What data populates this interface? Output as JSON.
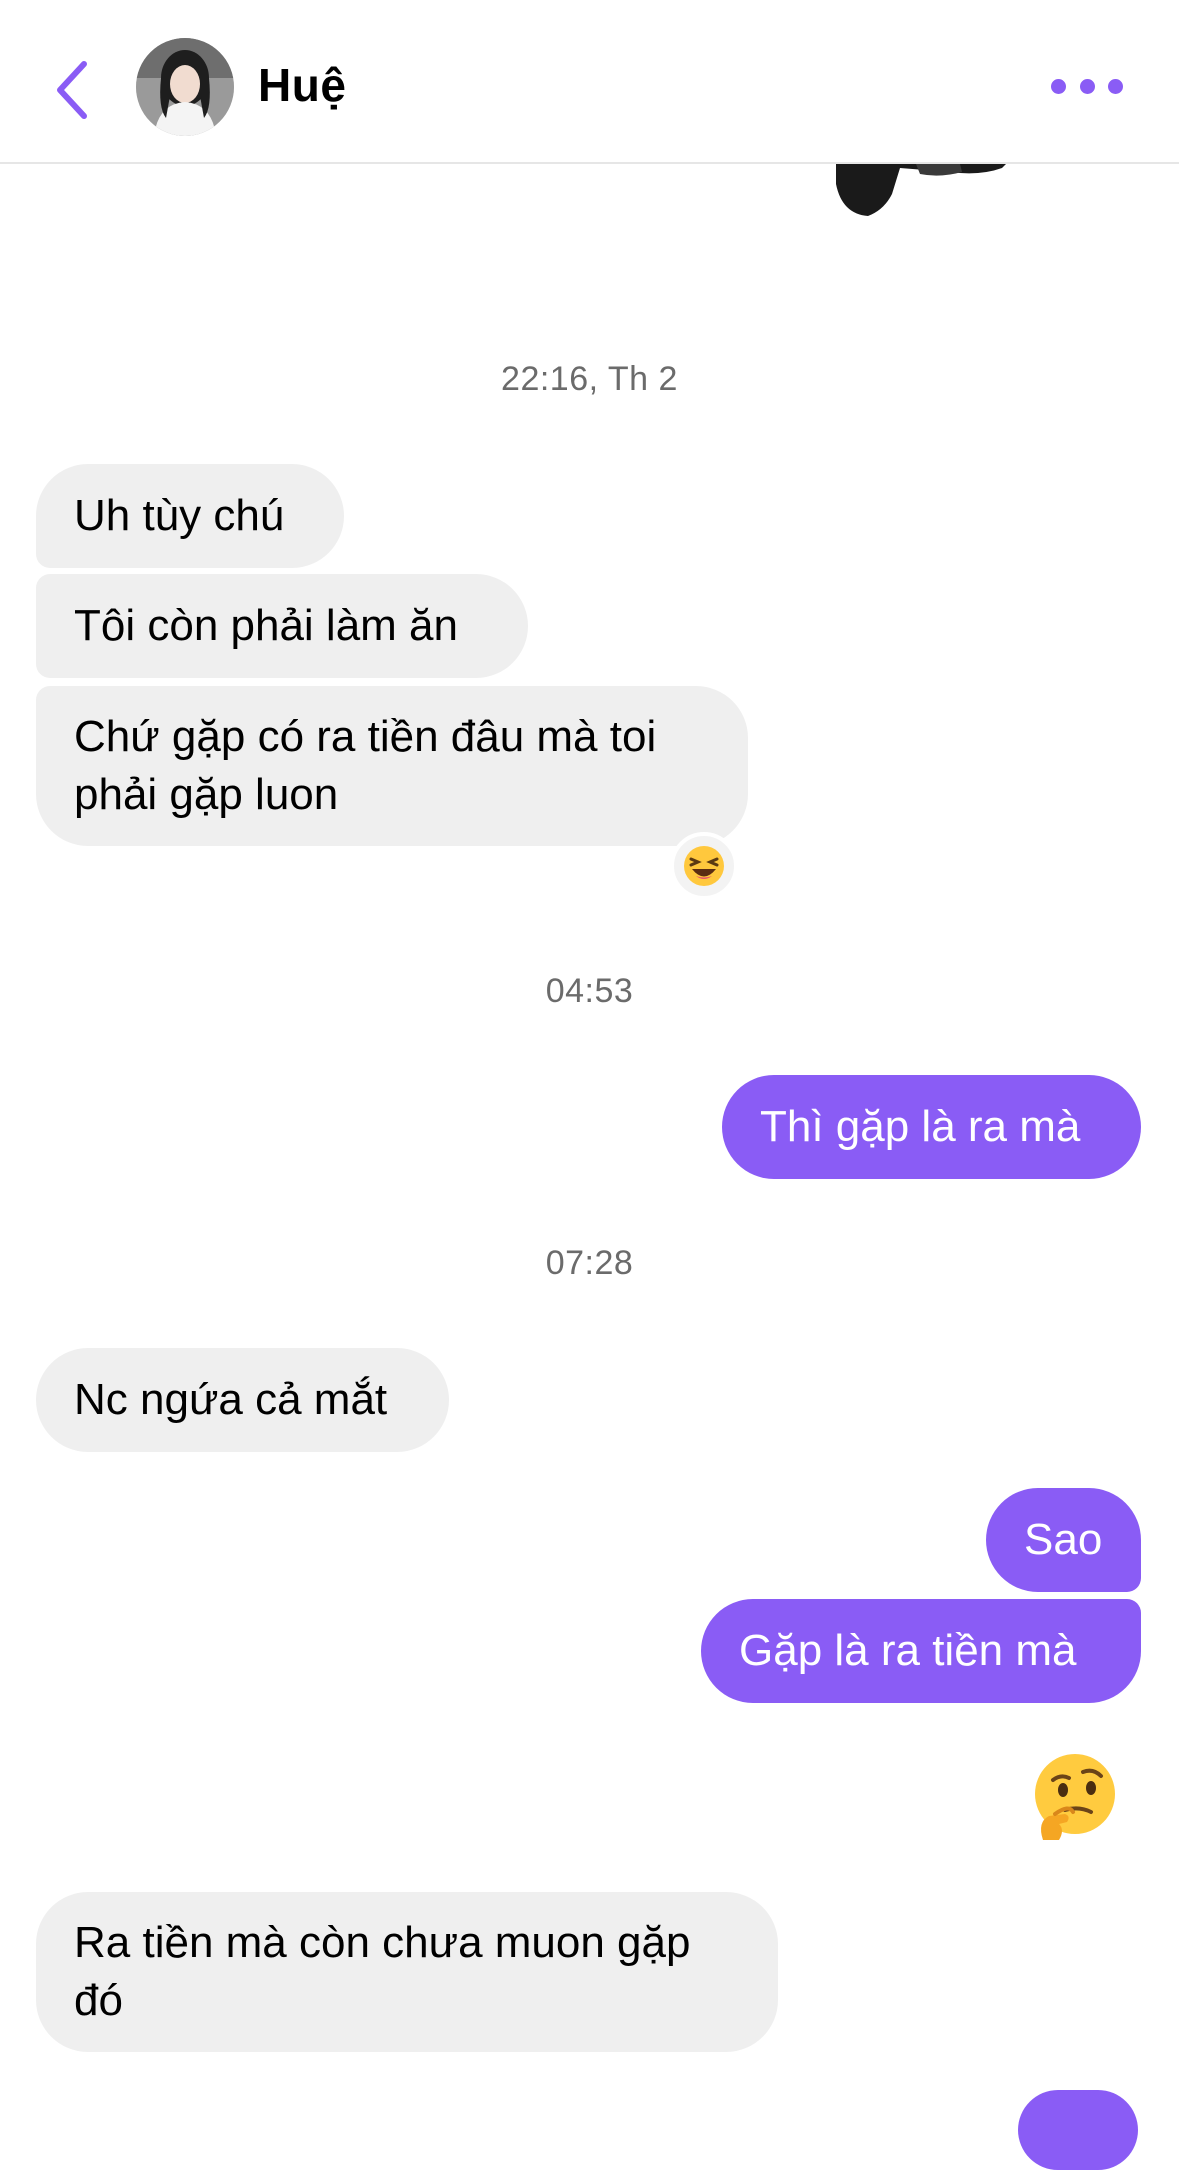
{
  "header": {
    "contact_name": "Huệ",
    "back_icon": "chevron-left-icon",
    "more_icon": "ellipsis-icon",
    "accent_color": "#8a5cf5"
  },
  "messages": {
    "timestamp_1": "22:16, Th 2",
    "m1": "Uh tùy chú",
    "m2": "Tôi còn phải làm ăn",
    "m3": "Chứ gặp có ra tiền đâu mà toi phải gặp luon",
    "m3_reaction": "laughing-face-emoji",
    "timestamp_2": "04:53",
    "m4": "Thì gặp là ra mà",
    "timestamp_3": "07:28",
    "m5": "Nc ngứa cả mắt",
    "m6": "Sao",
    "m7": "Gặp là ra tiền mà",
    "m8_emoji": "thinking-face-emoji",
    "m9": "Ra tiền mà còn chưa muon gặp đó"
  },
  "colors": {
    "incoming_bubble": "#efefef",
    "outgoing_bubble": "#8a5cf5",
    "timestamp_text": "#6b6b6b"
  }
}
